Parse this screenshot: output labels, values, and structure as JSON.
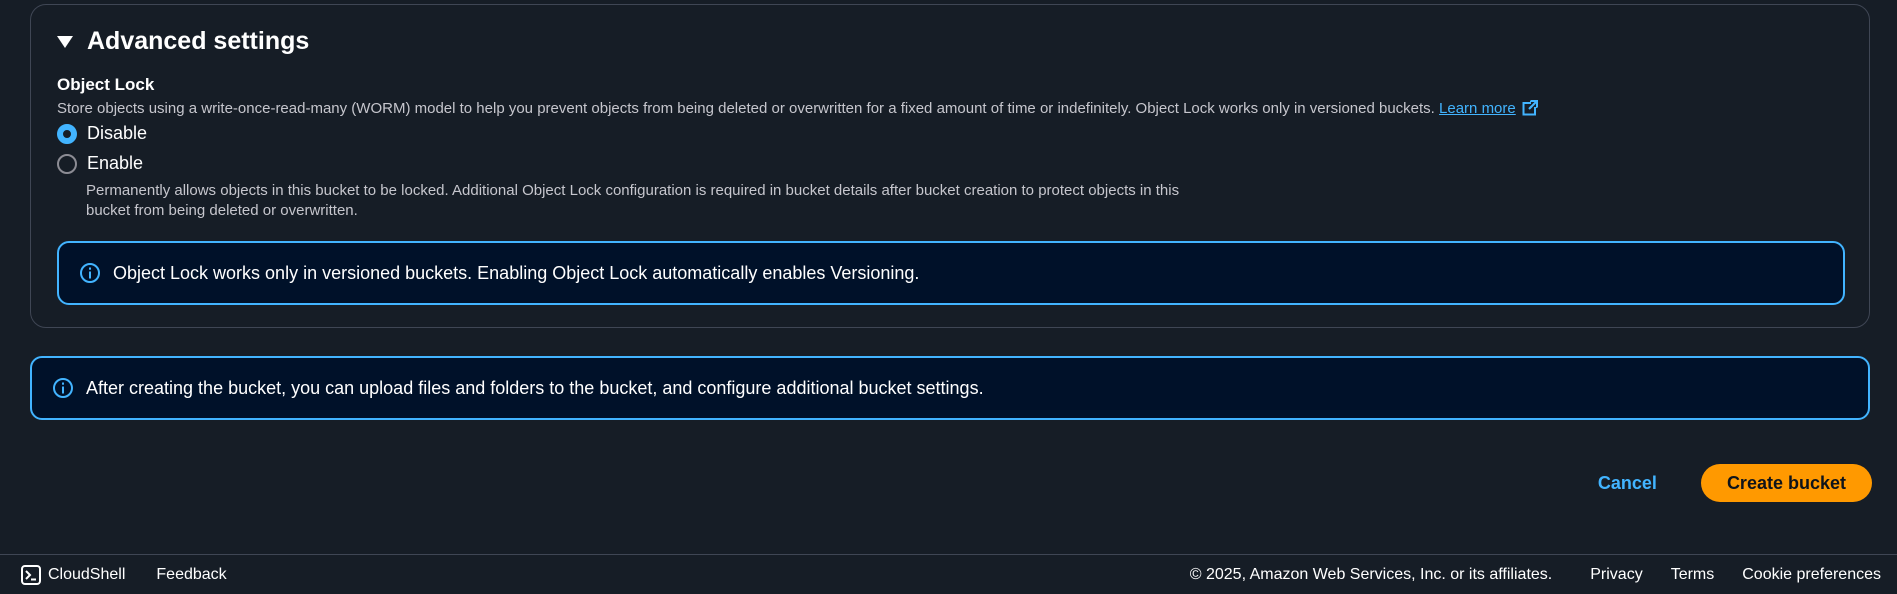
{
  "advanced": {
    "title": "Advanced settings",
    "object_lock_label": "Object Lock",
    "object_lock_desc": "Store objects using a write-once-read-many (WORM) model to help you prevent objects from being deleted or overwritten for a fixed amount of time or indefinitely. Object Lock works only in versioned buckets.",
    "learn_more": "Learn more",
    "options": [
      {
        "label": "Disable",
        "checked": true
      },
      {
        "label": "Enable",
        "checked": false
      }
    ],
    "enable_desc_line1": "Permanently allows objects in this bucket to be locked. Additional Object Lock configuration is required in bucket details after bucket creation to protect objects in this",
    "enable_desc_line2": "bucket from being deleted or overwritten.",
    "alert": "Object Lock works only in versioned buckets. Enabling Object Lock automatically enables Versioning."
  },
  "info_alert": "After creating the bucket, you can upload files and folders to the bucket, and configure additional bucket settings.",
  "actions": {
    "cancel": "Cancel",
    "create": "Create bucket"
  },
  "footer": {
    "cloudshell": "CloudShell",
    "feedback": "Feedback",
    "copyright": "© 2025, Amazon Web Services, Inc. or its affiliates.",
    "privacy": "Privacy",
    "terms": "Terms",
    "cookies": "Cookie preferences"
  },
  "colors": {
    "accent": "#42b4ff",
    "primary_button": "#ff9900",
    "background": "#161d26",
    "alert_background": "#001129"
  }
}
